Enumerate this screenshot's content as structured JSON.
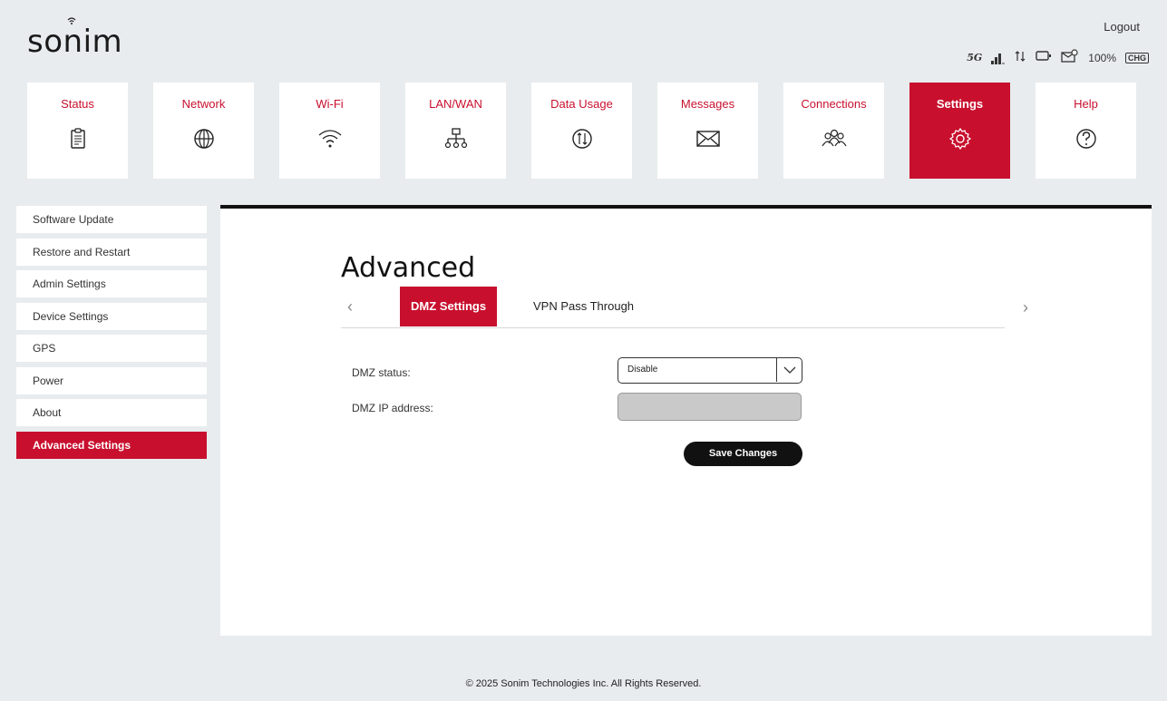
{
  "brand": {
    "logo_text": "sonim"
  },
  "header": {
    "logout_label": "Logout",
    "network_type": "5G",
    "battery_percent": "100%",
    "battery_badge": "CHG"
  },
  "topnav": [
    {
      "label": "Status",
      "icon": "clipboard-icon"
    },
    {
      "label": "Network",
      "icon": "globe-icon"
    },
    {
      "label": "Wi-Fi",
      "icon": "wifi-icon"
    },
    {
      "label": "LAN/WAN",
      "icon": "lan-icon"
    },
    {
      "label": "Data Usage",
      "icon": "data-usage-icon"
    },
    {
      "label": "Messages",
      "icon": "envelope-icon"
    },
    {
      "label": "Connections",
      "icon": "users-icon"
    },
    {
      "label": "Settings",
      "icon": "gear-icon",
      "active": true
    },
    {
      "label": "Help",
      "icon": "help-icon"
    }
  ],
  "sidebar": [
    {
      "label": "Software Update"
    },
    {
      "label": "Restore and Restart"
    },
    {
      "label": "Admin Settings"
    },
    {
      "label": "Device Settings"
    },
    {
      "label": "GPS"
    },
    {
      "label": "Power"
    },
    {
      "label": "About"
    },
    {
      "label": "Advanced Settings",
      "active": true
    }
  ],
  "main": {
    "title": "Advanced",
    "tabs": [
      {
        "label": "DMZ Settings",
        "active": true
      },
      {
        "label": "VPN Pass Through"
      }
    ],
    "form": {
      "dmz_status_label": "DMZ status:",
      "dmz_status_value": "Disable",
      "dmz_ip_label": "DMZ IP address:",
      "dmz_ip_value": "",
      "save_label": "Save Changes"
    }
  },
  "footer": {
    "copyright": "© 2025 Sonim Technologies Inc. All Rights Reserved."
  },
  "colors": {
    "accent": "#c8102e",
    "background": "#e8ecee",
    "panel": "#ffffff"
  }
}
